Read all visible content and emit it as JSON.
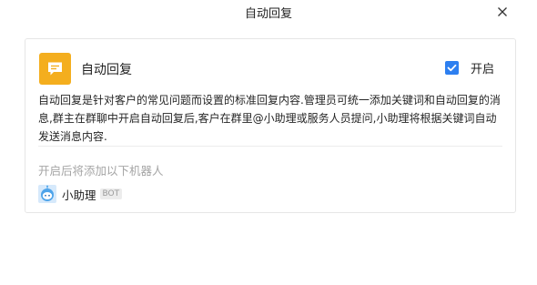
{
  "window": {
    "title": "自动回复",
    "close_icon": "close-icon"
  },
  "feature": {
    "icon": "message-icon",
    "icon_color": "#f4ae1e",
    "name": "自动回复",
    "toggle_label": "开启",
    "enabled": true,
    "accent_color": "#2d7ff0",
    "description": "自动回复是针对客户的常见问题而设置的标准回复内容.管理员可统一添加关键词和自动回复的消息,群主在群聊中开启自动回复后,客户在群里@小助理或服务人员提问,小助理将根据关键词自动发送消息内容."
  },
  "bots": {
    "label": "开启后将添加以下机器人",
    "items": [
      {
        "avatar": "bot-avatar-icon",
        "name": "小助理",
        "badge": "BOT"
      }
    ]
  }
}
